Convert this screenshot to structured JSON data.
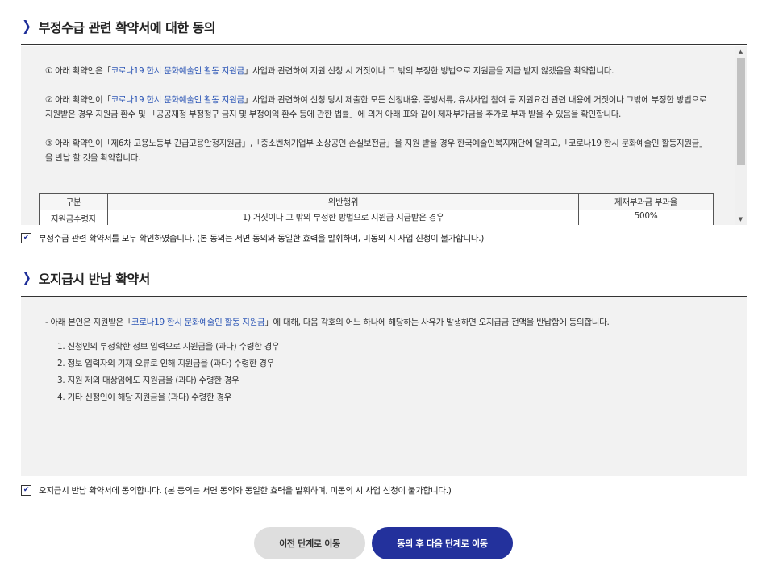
{
  "section1": {
    "title": "부정수급 관련 확약서에 대한 동의",
    "para1_pre": "① 아래 확약인은「",
    "para1_hl": "코로나19 한시 문화예술인 활동 지원금",
    "para1_post": "」사업과 관련하여 지원 신청 시 거짓이나 그 밖의 부정한 방법으로 지원금을 지급 받지 않겠음을 확약합니다.",
    "para2_pre": "② 아래 확약인이「",
    "para2_hl": "코로나19 한시 문화예술인 활동 지원금",
    "para2_post": "」사업과 관련하여 신청 당시 제출한 모든 신청내용, 증빙서류, 유사사업 참여 등 지원요건 관련 내용에 거짓이나 그밖에 부정한 방법으로 지원받은 경우 지원금 환수 및 「공공재정 부정청구 금지 및 부정이익 환수 등에 관한 법률」에 의거 아래 표와 같이 제재부가금을 추가로 부과 받을 수 있음을 확인합니다.",
    "para3": "③ 아래 확약인이「제6차 고용노동부 긴급고용안정지원금」,「중소벤처기업부 소상공인 손실보전금」을 지원 받을 경우 한국예술인복지재단에 알리고,「코로나19 한시 문화예술인 활동지원금」을 반납 할 것을 확약합니다.",
    "table": {
      "headers": [
        "구분",
        "위반행위",
        "제재부과금 부과율"
      ],
      "rows": [
        [
          "지원금수령자",
          "1) 거짓이나 그 밖의 부정한 방법으로 지원금 지급받은 경우",
          "500%"
        ]
      ]
    },
    "checkbox_label": "부정수급 관련 확약서를 모두 확인하였습니다. (본 동의는 서면 동의와 동일한 효력을 발휘하며, 미동의 시 사업 신청이 불가합니다.)",
    "checked": true
  },
  "section2": {
    "title": "오지급시 반납 확약서",
    "intro_pre": "- 아래 본인은 지원받은「",
    "intro_hl": "코로나19 한시 문화예술인 활동 지원금",
    "intro_post": "」에 대해, 다음 각호의 어느 하나에 해당하는 사유가 발생하면 오지급금 전액을 반납함에 동의합니다.",
    "items": [
      "1. 신청인의 부정확한 정보 입력으로 지원금을 (과다) 수령한 경우",
      "2. 정보 입력자의 기재 오류로 인해 지원금을 (과다) 수령한 경우",
      "3. 지원 제외 대상임에도 지원금을 (과다) 수령한 경우",
      "4. 기타 신청인이 해당 지원금을 (과다) 수령한 경우"
    ],
    "checkbox_label": "오지급시 반납 확약서에 동의합니다. (본 동의는 서면 동의와 동일한 효력을 발휘하며, 미동의 시 사업 신청이 불가합니다.)",
    "checked": true
  },
  "buttons": {
    "prev": "이전 단계로 이동",
    "next": "동의 후 다음 단계로 이동"
  },
  "colors": {
    "accent": "#23319c",
    "highlight": "#2b55b5",
    "box_bg": "#f2f2f2"
  },
  "icons": {
    "section_marker": "chevron-right-icon",
    "checkbox": "checkmark-icon"
  }
}
